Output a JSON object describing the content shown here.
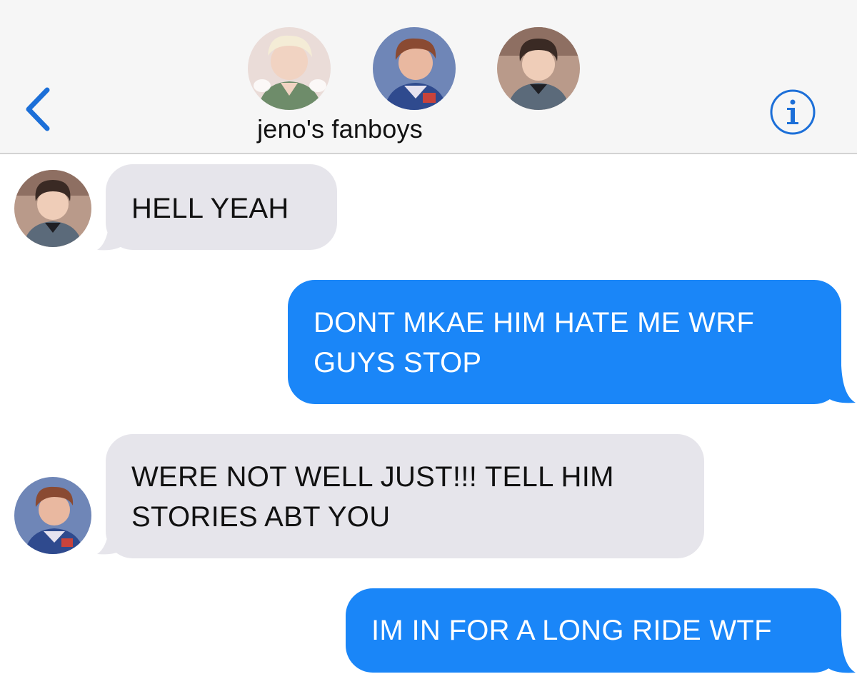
{
  "header": {
    "title": "jeno's fanboys",
    "back_icon": "chevron-left-icon",
    "info_icon": "info-icon",
    "accent_color": "#1c6fd8",
    "participants": [
      {
        "avatar": "participant-avatar-1"
      },
      {
        "avatar": "participant-avatar-2"
      },
      {
        "avatar": "participant-avatar-3"
      }
    ]
  },
  "messages": [
    {
      "direction": "received",
      "text": "HELL YEAH",
      "avatar": "sender-avatar-3"
    },
    {
      "direction": "sent",
      "text": "DONT MKAE HIM HATE ME WRF\nGUYS STOP"
    },
    {
      "direction": "received",
      "text": "WERE NOT WELL JUST!!! TELL HIM\nSTORIES ABT YOU",
      "avatar": "sender-avatar-2"
    },
    {
      "direction": "sent",
      "text": "IM IN FOR A LONG RIDE WTF"
    }
  ],
  "colors": {
    "sent_bubble": "#1a86f8",
    "received_bubble": "#e6e5eb",
    "header_bg": "#f6f6f6"
  }
}
